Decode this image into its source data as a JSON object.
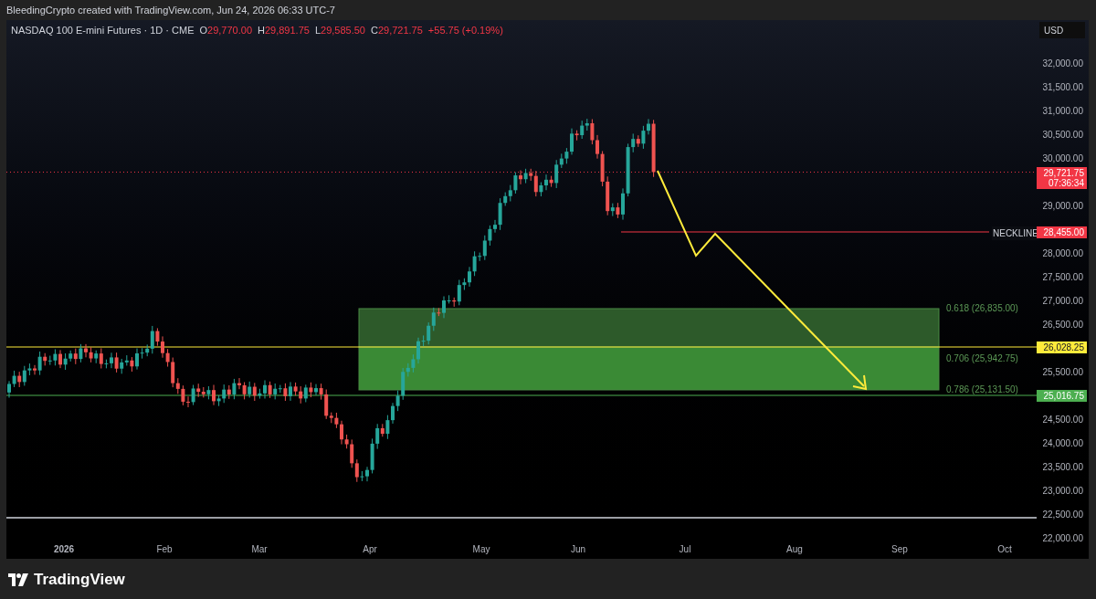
{
  "attribution": "BleedingCrypto created with TradingView.com, Jun 24, 2026 06:33 UTC-7",
  "legend": {
    "symbol": "NASDAQ 100 E-mini Futures · 1D · CME",
    "falling": true,
    "fields": [
      {
        "label": "O",
        "value": "29,770.00"
      },
      {
        "label": "H",
        "value": "29,891.75"
      },
      {
        "label": "L",
        "value": "29,585.50"
      },
      {
        "label": "C",
        "value": "29,721.75"
      }
    ],
    "change": "+55.75 (+0.19%)"
  },
  "price_axis": {
    "currency": "USD",
    "ticks": [
      "32,000.00",
      "31,500.00",
      "31,000.00",
      "30,500.00",
      "30,000.00",
      "29,000.00",
      "28,000.00",
      "27,500.00",
      "27,000.00",
      "26,500.00",
      "25,500.00",
      "24,500.00",
      "24,000.00",
      "23,500.00",
      "23,000.00",
      "22,500.00",
      "22,000.00"
    ]
  },
  "price_tags": [
    {
      "kind": "last",
      "price": "29,721.75",
      "countdown": "07:36:34",
      "color": "#f23645"
    },
    {
      "kind": "line",
      "price": "28,455.00",
      "line_label": "NECKLINE",
      "color": "#f23645"
    },
    {
      "kind": "line",
      "price": "26,028.25",
      "color": "#ffeb3b"
    },
    {
      "kind": "line",
      "price": "25,016.75",
      "color": "#4caf50"
    }
  ],
  "fib_levels": [
    "0.618 (26,835.00)",
    "0.706 (25,942.75)",
    "0.786 (25,131.50)"
  ],
  "time_axis": [
    {
      "label": "2026",
      "kind": "year"
    },
    {
      "label": "Feb",
      "kind": "month"
    },
    {
      "label": "Mar",
      "kind": "month"
    },
    {
      "label": "Apr",
      "kind": "month"
    },
    {
      "label": "May",
      "kind": "month"
    },
    {
      "label": "Jun",
      "kind": "month"
    },
    {
      "label": "Jul",
      "kind": "month"
    },
    {
      "label": "Aug",
      "kind": "month"
    },
    {
      "label": "Sep",
      "kind": "month"
    },
    {
      "label": "Oct",
      "kind": "month"
    }
  ],
  "footer": {
    "brand": "TradingView"
  }
}
